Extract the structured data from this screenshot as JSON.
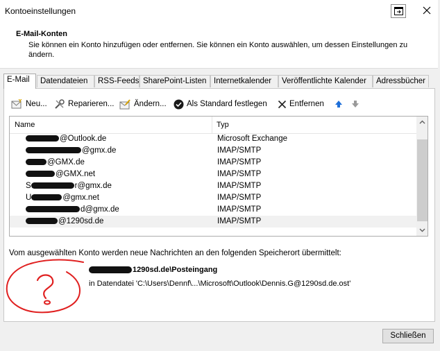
{
  "window": {
    "title": "Kontoeinstellungen"
  },
  "header": {
    "title": "E-Mail-Konten",
    "description": "Sie können ein Konto hinzufügen oder entfernen. Sie können ein Konto auswählen, um dessen Einstellungen zu ändern."
  },
  "tabs": [
    {
      "label": "E-Mail",
      "active": true
    },
    {
      "label": "Datendateien"
    },
    {
      "label": "RSS-Feeds"
    },
    {
      "label": "SharePoint-Listen"
    },
    {
      "label": "Internetkalender"
    },
    {
      "label": "Veröffentlichte Kalender"
    },
    {
      "label": "Adressbücher"
    }
  ],
  "toolbar": {
    "new_label": "Neu...",
    "repair_label": "Reparieren...",
    "change_label": "Ändern...",
    "default_label": "Als Standard festlegen",
    "remove_label": "Entfernen",
    "icons": [
      "new-mail-icon",
      "wrench-icon",
      "change-icon",
      "checkmark-icon",
      "x-icon",
      "arrow-up-icon",
      "arrow-down-icon"
    ]
  },
  "list": {
    "columns": [
      "Name",
      "Typ"
    ],
    "rows": [
      {
        "name": "@Outlook.de",
        "type": "Microsoft Exchange"
      },
      {
        "name": "@gmx.de",
        "type": "IMAP/SMTP"
      },
      {
        "name": "@GMX.de",
        "type": "IMAP/SMTP"
      },
      {
        "name": "@GMX.net",
        "type": "IMAP/SMTP"
      },
      {
        "name": "S",
        "name_tail": "r@gmx.de",
        "type": "IMAP/SMTP"
      },
      {
        "name": "U",
        "name_tail": "@gmx.net",
        "type": "IMAP/SMTP"
      },
      {
        "name": "d@gmx.de",
        "type": "IMAP/SMTP"
      },
      {
        "name": "@1290sd.de",
        "type": "IMAP/SMTP",
        "selected": true
      }
    ]
  },
  "delivery": {
    "info": "Vom ausgewählten Konto werden neue Nachrichten an den folgenden Speicherort übermittelt:",
    "folder": "1290sd.de\\Posteingang",
    "file": "in Datendatei 'C:\\Users\\Dennf\\...\\Microsoft\\Outlook\\Dennis.G@1290sd.de.ost'"
  },
  "footer": {
    "close_label": "Schließen"
  },
  "colors": {
    "annotation": "#e02020",
    "selection": "#f1f1f1",
    "accent": "#1e6fd9"
  }
}
